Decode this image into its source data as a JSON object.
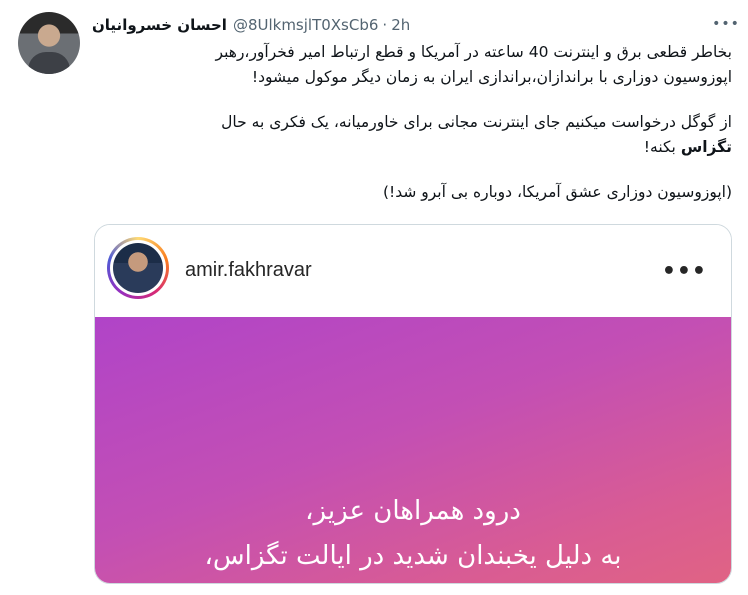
{
  "tweet": {
    "author_name": "احسان خسروانیان",
    "handle": "@8UlkmsjlT0XsCb6",
    "separator": "·",
    "time": "2h",
    "more_icon": "more-horizontal-icon",
    "line1": "بخاطر قطعی برق و اینترنت 40 ساعته در آمریکا و قطع ارتباط امیر فخرآور،رهبر",
    "line2": "اپوزوسیون دوزاری با براندازان،براندازی ایران به زمان دیگر موکول میشود!",
    "line3": "از گوگل درخواست میکنیم جای اینترنت مجانی برای خاورمیانه، یک فکری به حال",
    "line4_bold": "تگزاس",
    "line4_rest": " بکنه!",
    "line5": "(اپوزوسیون دوزاری عشق آمریکا، دوباره بی آبرو شد!)"
  },
  "card": {
    "ig_handle": "amir.fakhravar",
    "ig_more_icon": "more-horizontal-icon",
    "post_line1": "درود همراهان عزیز،",
    "post_line2": "به دلیل یخبندان شدید در ایالت تگزاس،",
    "post_line3": "..."
  },
  "colors": {
    "text": "#0f1419",
    "secondary": "#536471",
    "border": "#cfd9de",
    "post_gradient_start": "#b044c8",
    "post_gradient_end": "#e06384"
  }
}
